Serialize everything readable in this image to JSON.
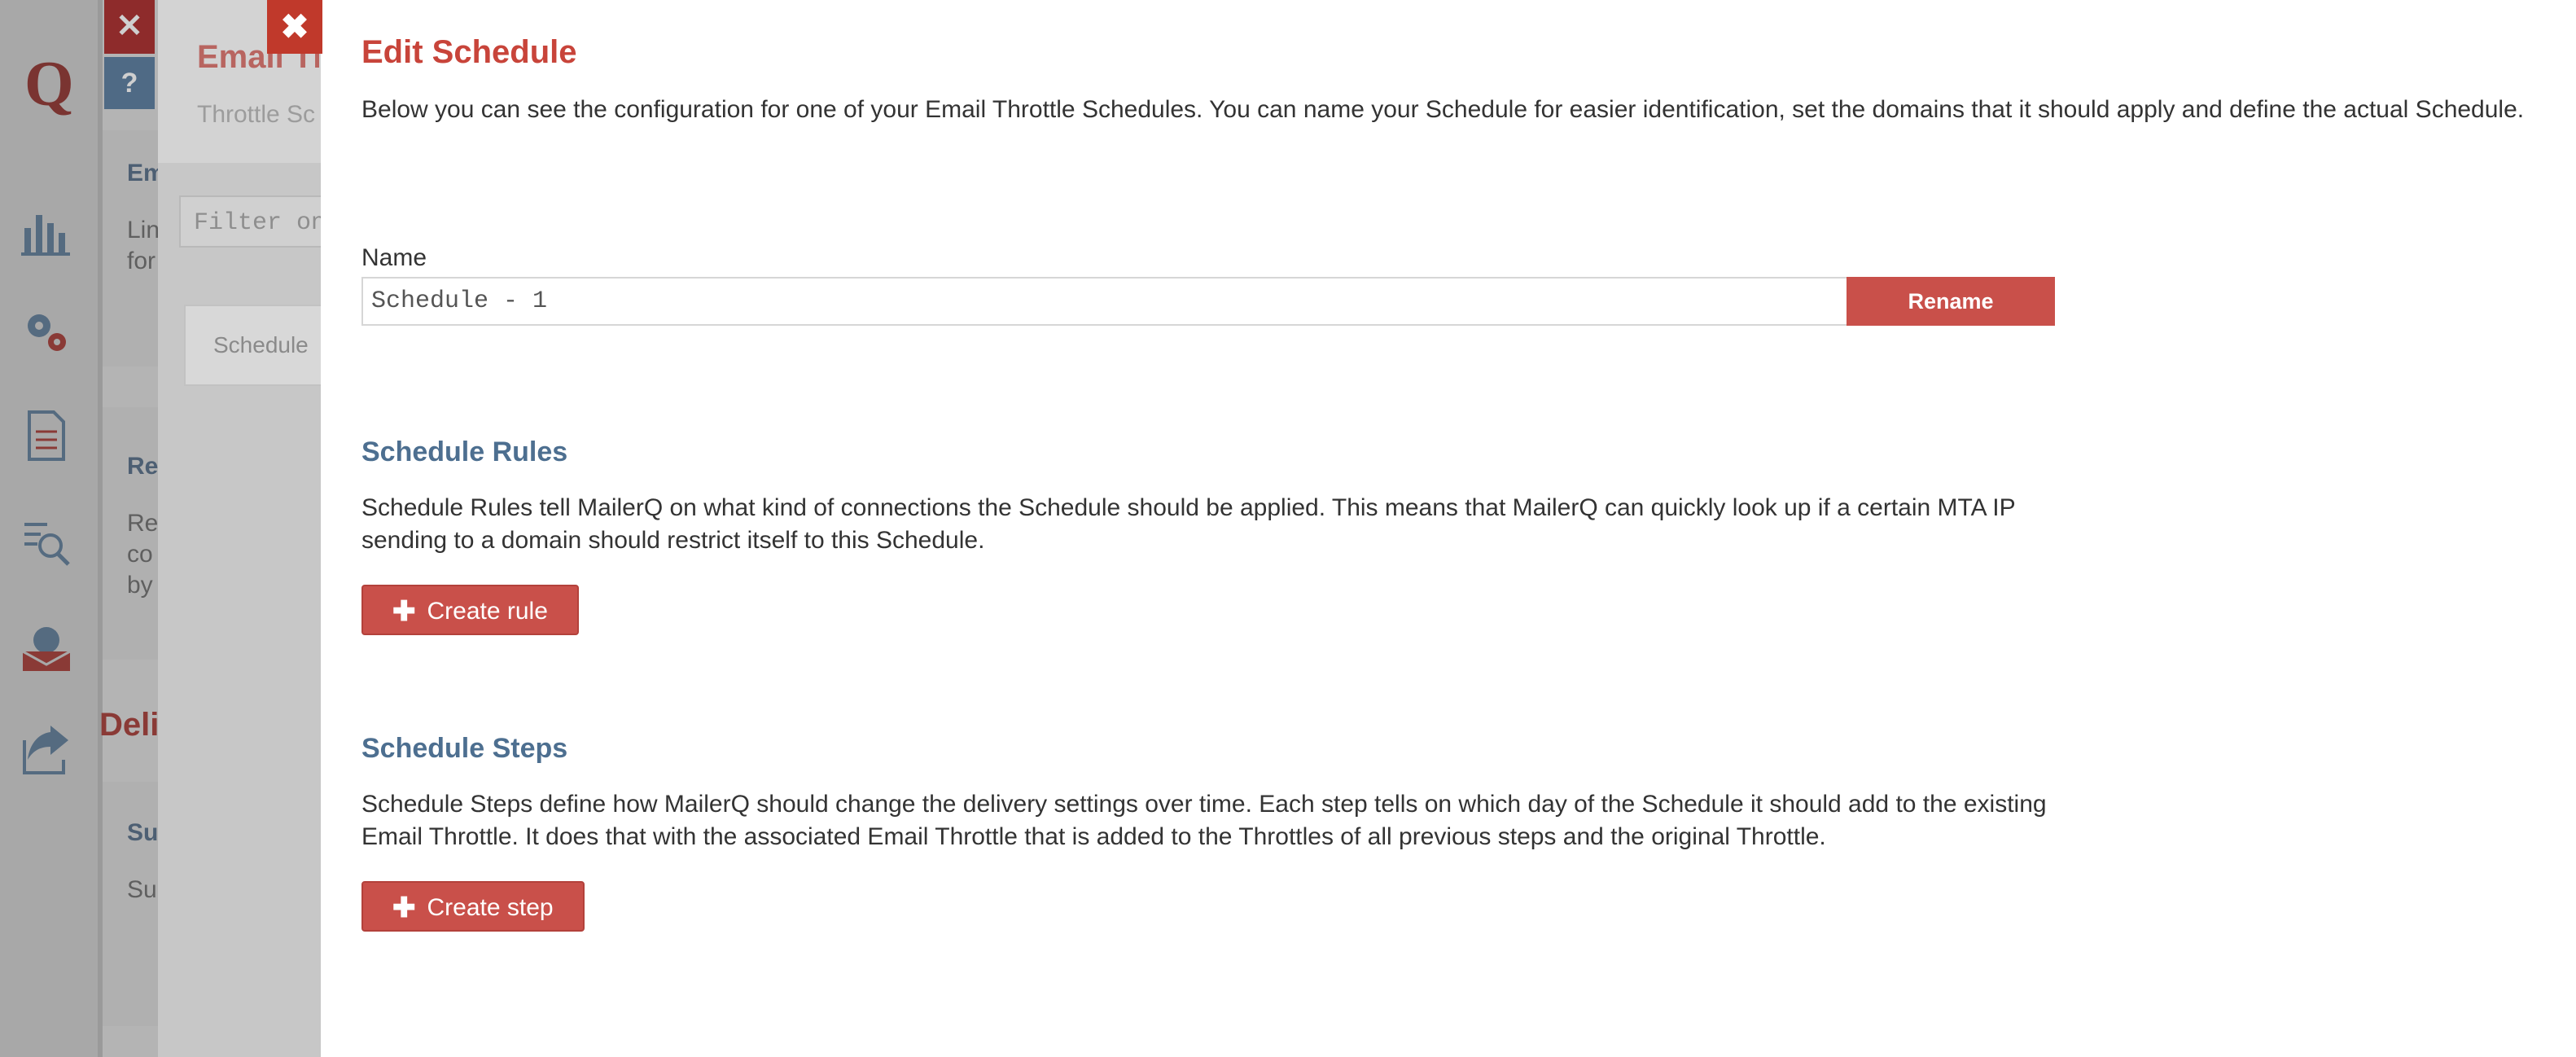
{
  "background": {
    "logo": "Q",
    "bg_close": "✕",
    "bg_help": "?",
    "panel_title_frag": "Email Th",
    "panel_sub_frag": "Throttle Sc",
    "filter_placeholder": "Filter on",
    "list_item_frag": "Schedule",
    "card1_title_frag": "Em",
    "card1_text1": "Lin",
    "card1_text2": "for",
    "card2_title_frag": "Re",
    "card2_text1": "Re",
    "card2_text2": "co",
    "card2_text3": "by",
    "section_frag": "Deli",
    "card3_text1": "Su",
    "card3_text2": "Su"
  },
  "modal": {
    "close_symbol": "✖",
    "title": "Edit Schedule",
    "intro": "Below you can see the configuration for one of your Email Throttle Schedules. You can name your Schedule for easier identification, set the domains that it should apply and define the actual Schedule.",
    "name_label": "Name",
    "name_value": "Schedule - 1",
    "rename_label": "Rename",
    "rules_title": "Schedule Rules",
    "rules_text": "Schedule Rules tell MailerQ on what kind of connections the Schedule should be applied. This means that MailerQ can quickly look up if a certain MTA IP sending to a domain should restrict itself to this Schedule.",
    "create_rule_label": "Create rule",
    "steps_title": "Schedule Steps",
    "steps_text": "Schedule Steps define how MailerQ should change the delivery settings over time. Each step tells on which day of the Schedule it should add to the existing Email Throttle. It does that with the associated Email Throttle that is added to the Throttles of all previous steps and the original Throttle.",
    "create_step_label": "Create step",
    "plus_symbol": "✚"
  },
  "colors": {
    "accent": "#c9504a",
    "title": "#c8443a",
    "section": "#4d6f90"
  }
}
